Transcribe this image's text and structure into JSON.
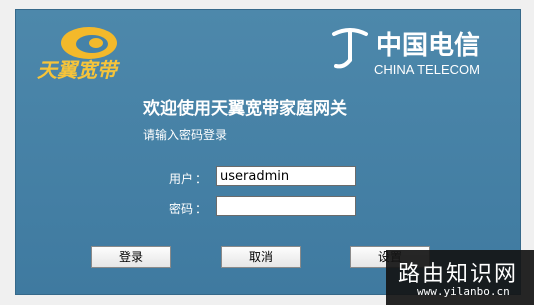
{
  "header": {
    "left_logo_text": "天翼宽带",
    "right_logo_cn": "中国电信",
    "right_logo_en": "CHINA TELECOM"
  },
  "login": {
    "welcome": "欢迎使用天翼宽带家庭网关",
    "subtitle": "请输入密码登录",
    "username_label": "用户",
    "password_label": "密码",
    "colon": "：",
    "username_value": "useradmin",
    "password_value": ""
  },
  "buttons": {
    "login": "登录",
    "cancel": "取消",
    "settings": "设置"
  },
  "watermark": {
    "title": "路由知识网",
    "url": "www.yilanbo.cn"
  },
  "colors": {
    "panel_bg": "#4582a8",
    "logo_yellow": "#f3b92b",
    "logo_blue": "#1f5f9a"
  }
}
